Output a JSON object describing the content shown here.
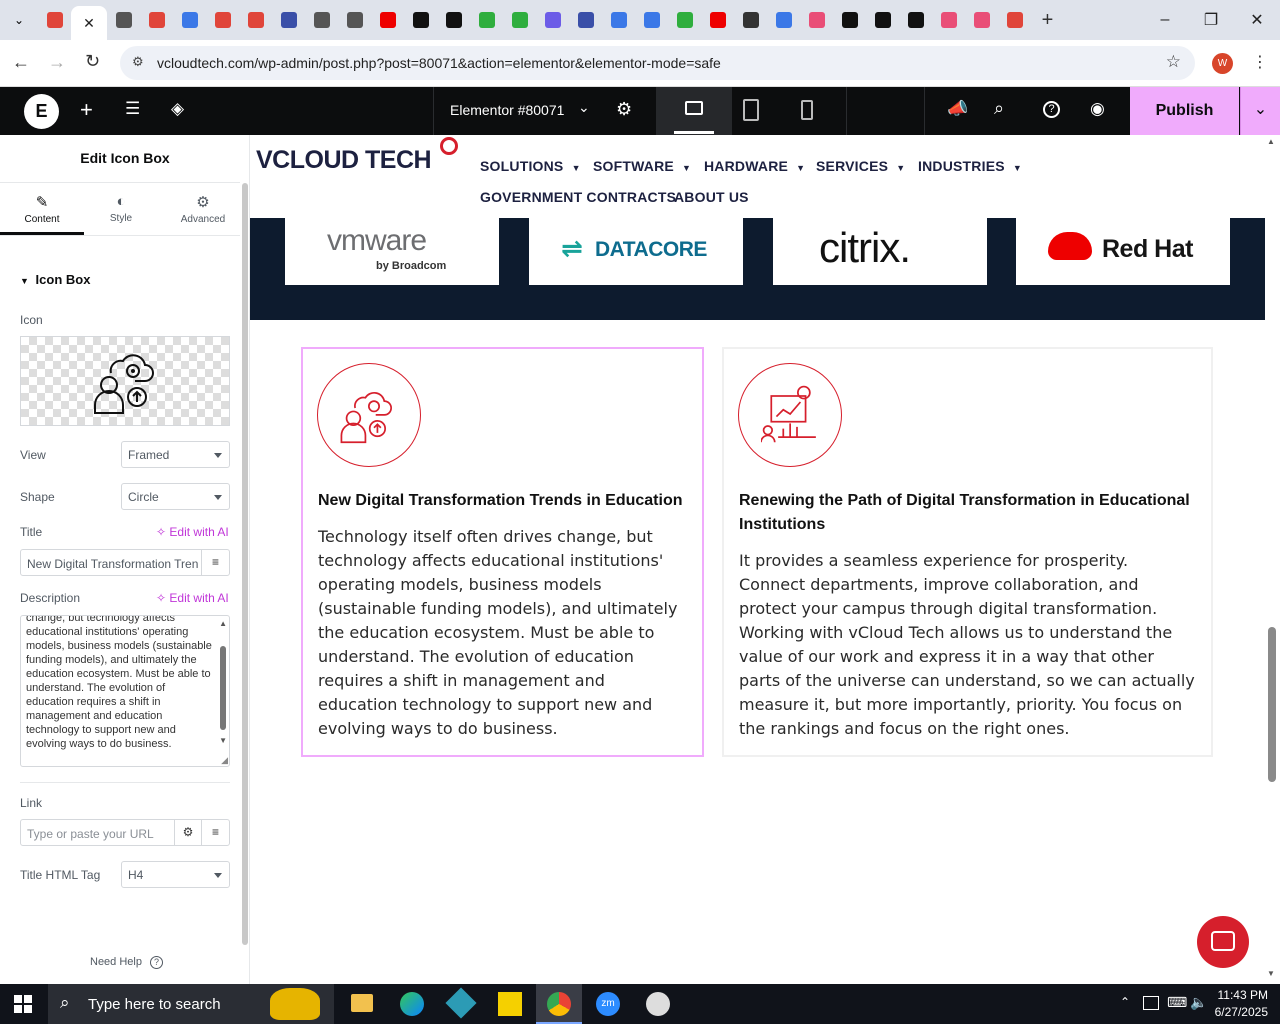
{
  "browser": {
    "url": "vcloudtech.com/wp-admin/post.php?post=80071&action=elementor&elementor-mode=safe",
    "profile_initial": "W",
    "tab_colors": [
      "#e0453a",
      "#e0453a",
      "#555",
      "#e0453a",
      "#3b78e7",
      "#e0453a",
      "#e0453a",
      "#3a4fa8",
      "#555",
      "#555",
      "#e00",
      "#111",
      "#111",
      "#2fae3e",
      "#2fae3e",
      "#6c5ce7",
      "#3a4fa8",
      "#3b78e7",
      "#3b78e7",
      "#2fae3e",
      "#e00",
      "#333",
      "#3b78e7",
      "#e94e77",
      "#111",
      "#111",
      "#111",
      "#e94e77",
      "#e94e77",
      "#e0453a"
    ]
  },
  "elementor": {
    "document_title": "Elementor #80071",
    "publish_label": "Publish"
  },
  "panel": {
    "title": "Edit Icon Box",
    "tabs": [
      {
        "label": "Content",
        "icon": "pencil-icon"
      },
      {
        "label": "Style",
        "icon": "contrast-icon"
      },
      {
        "label": "Advanced",
        "icon": "gear-icon"
      }
    ],
    "section": "Icon Box",
    "icon_label": "Icon",
    "view_label": "View",
    "view_value": "Framed",
    "shape_label": "Shape",
    "shape_value": "Circle",
    "title_label": "Title",
    "edit_ai": "Edit with AI",
    "title_value": "New Digital Transformation Tren",
    "description_label": "Description",
    "description_value": "change, but technology affects educational institutions' operating models, business models (sustainable funding models), and ultimately the education ecosystem. Must be able to understand. The evolution of education requires a shift in management and education technology to support new and evolving ways to do business.",
    "link_label": "Link",
    "link_placeholder": "Type or paste your URL",
    "html_tag_label": "Title HTML Tag",
    "html_tag_value": "H4",
    "need_help": "Need Help"
  },
  "site": {
    "logo_text": "VCLOUD TECH",
    "nav": [
      {
        "label": "SOLUTIONS",
        "dropdown": true
      },
      {
        "label": "SOFTWARE",
        "dropdown": true
      },
      {
        "label": "HARDWARE",
        "dropdown": true
      },
      {
        "label": "SERVICES",
        "dropdown": true
      },
      {
        "label": "INDUSTRIES",
        "dropdown": true
      },
      {
        "label": "GOVERNMENT CONTRACTS",
        "dropdown": false
      },
      {
        "label": "ABOUT US",
        "dropdown": false
      }
    ],
    "partners": [
      {
        "name": "vmware",
        "sub": "by Broadcom"
      },
      {
        "name": "DATACORE"
      },
      {
        "name": "citrix."
      },
      {
        "name": "Red Hat"
      }
    ],
    "boxes": [
      {
        "title": "New Digital Transformation Trends in Education",
        "description": "Technology itself often drives change, but technology affects educational institutions' operating models, business models (sustainable funding models), and ultimately the education ecosystem. Must be able to understand. The evolution of education requires a shift in management and education technology to support new and evolving ways to do business."
      },
      {
        "title": "Renewing the Path of Digital Transformation in Educational Institutions",
        "description": "It provides a seamless experience for prosperity. Connect departments, improve collaboration, and protect your campus through digital transformation. Working with vCloud Tech allows us to understand the value of our work and express it in a way that other parts of the universe can understand, so we can actually measure it, but more importantly, priority. You focus on the rankings and focus on the right ones."
      }
    ],
    "accent": "#d61f2c"
  },
  "taskbar": {
    "search_placeholder": "Type here to search",
    "time": "11:43 PM",
    "date": "6/27/2025"
  }
}
